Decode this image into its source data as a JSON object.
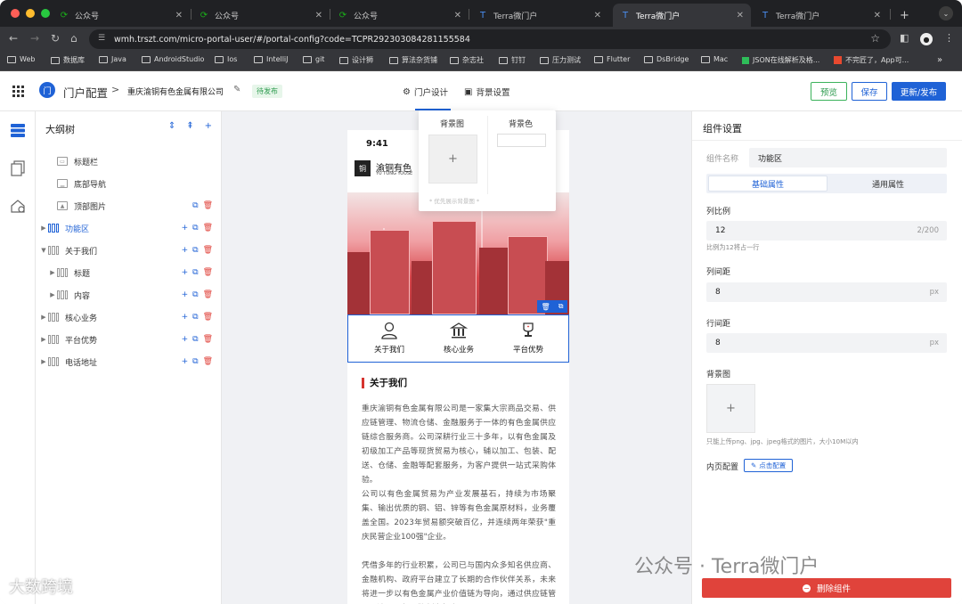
{
  "browser": {
    "tabs": [
      {
        "label": "公众号",
        "icon": "wechat-icon"
      },
      {
        "label": "公众号",
        "icon": "wechat-icon"
      },
      {
        "label": "公众号",
        "icon": "wechat-icon"
      },
      {
        "label": "Terra微门户",
        "icon": "terra-icon"
      },
      {
        "label": "Terra微门户",
        "icon": "terra-icon"
      },
      {
        "label": "Terra微门户",
        "icon": "terra-icon"
      }
    ],
    "url": "wmh.trszt.com/micro-portal-user/#/portal-config?code=TCPR292303084281155584",
    "bookmarks": [
      "Web",
      "数据库",
      "Java",
      "AndroidStudio",
      "Ios",
      "IntelliJ",
      "git",
      "设计狮",
      "算法杂货铺",
      "杂志社",
      "钉钉",
      "压力测试",
      "Flutter",
      "DsBridge",
      "Mac",
      "JSON在线解析及格...",
      "不完匠了，App可..."
    ],
    "overflow": "»"
  },
  "header": {
    "app_title": "门户配置",
    "crumb_sep": ">",
    "company": "重庆渝铜有色金属有限公司",
    "status_badge": "待发布",
    "menu_design": "门户设计",
    "menu_bg": "背景设置",
    "btn_preview": "预览",
    "btn_save": "保存",
    "btn_publish": "更新/发布",
    "logo_text": "门"
  },
  "tree": {
    "title": "大纲树",
    "nodes": [
      {
        "label": "标题栏"
      },
      {
        "label": "底部导航"
      },
      {
        "label": "顶部图片"
      },
      {
        "label": "功能区"
      },
      {
        "label": "关于我们"
      },
      {
        "label": "标题"
      },
      {
        "label": "内容"
      },
      {
        "label": "核心业务"
      },
      {
        "label": "平台优势"
      },
      {
        "label": "电话地址"
      }
    ]
  },
  "phone": {
    "time": "9:41",
    "brand_name": "渝铜有色",
    "brand_sub": "YU TONG YOUSE",
    "logo_text": "铜",
    "functions": [
      "关于我们",
      "核心业务",
      "平台优势"
    ],
    "about_title": "关于我们",
    "paragraphs": [
      "重庆渝铜有色金属有限公司是一家集大宗商品交易、供应链管理、物流仓储、金融服务于一体的有色金属供应链综合服务商。公司深耕行业三十多年，以有色金属及初级加工产品等现货贸易为核心，辅以加工、包装、配送、仓储、金融等配套服务，为客户提供一站式采购体验。",
      "公司以有色金属贸易为产业发展基石，持续为市场聚集、输出优质的铜、铝、锌等有色金属原材料，业务覆盖全国。2023年贸易额突破百亿，并连续两年荣获\"重庆民营企业100强\"企业。",
      "凭借多年的行业积累，公司已与国内众多知名供应商、金融机构、政府平台建立了长期的合作伙伴关系，未来将进一步以有色金属产业价值链为导向，通过供应链管理、流通服务、供应链金融"
    ]
  },
  "popover": {
    "bg_image": "背景图",
    "bg_color": "背景色",
    "plus": "+",
    "note": "* 优先展示背景图 *"
  },
  "panel": {
    "title": "组件设置",
    "name_label": "组件名称",
    "name_value": "功能区",
    "tab_basic": "基础属性",
    "tab_common": "通用属性",
    "col_ratio_label": "列比例",
    "col_ratio_value": "12",
    "col_ratio_count": "2/200",
    "col_ratio_hint": "比例为12将占一行",
    "col_gap_label": "列间距",
    "col_gap_value": "8",
    "row_gap_label": "行间距",
    "row_gap_value": "8",
    "unit": "px",
    "bg_label": "背景图",
    "plus": "+",
    "upload_hint": "只能上传png、jpg、jpeg格式的图片，大小10M以内",
    "inner_label": "内页配置",
    "inner_btn": "点击配置",
    "delete_btn": "删除组件"
  },
  "watermarks": {
    "wm_right": "公众号 · Terra微门户",
    "wm_left": "大数跨境"
  },
  "colors": {
    "primary": "#1f62d6",
    "danger": "#e0433b",
    "success": "#2e9b4f"
  }
}
